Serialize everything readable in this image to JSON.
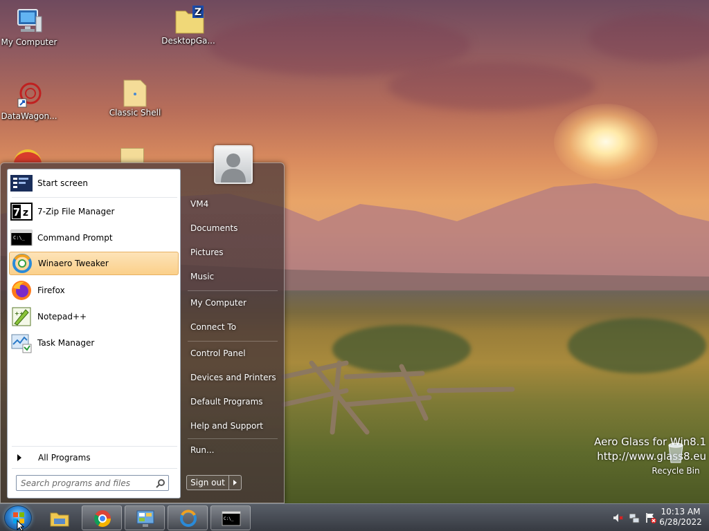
{
  "desktop": {
    "icons": [
      {
        "label": "My Computer"
      },
      {
        "label": "DesktopGa..."
      },
      {
        "label": "DataWagon..."
      },
      {
        "label": "Classic Shell"
      }
    ],
    "watermark": {
      "line1": "Aero Glass for Win8.1",
      "line2": "http://www.glass8.eu"
    },
    "recycle_bin": "Recycle Bin"
  },
  "start_menu": {
    "programs": [
      {
        "label": "Start screen"
      },
      {
        "label": "7-Zip File Manager"
      },
      {
        "label": "Command Prompt"
      },
      {
        "label": "Winaero Tweaker"
      },
      {
        "label": "Firefox"
      },
      {
        "label": "Notepad++"
      },
      {
        "label": "Task Manager"
      }
    ],
    "all_programs": "All Programs",
    "search_placeholder": "Search programs and files",
    "right_items": [
      {
        "label": "VM4"
      },
      {
        "label": "Documents"
      },
      {
        "label": "Pictures"
      },
      {
        "label": "Music"
      },
      {
        "label": "My Computer"
      },
      {
        "label": "Connect To"
      },
      {
        "label": "Control Panel"
      },
      {
        "label": "Devices and Printers"
      },
      {
        "label": "Default Programs"
      },
      {
        "label": "Help and Support"
      },
      {
        "label": "Run..."
      }
    ],
    "sign_out": "Sign out"
  },
  "taskbar": {
    "clock_time": "10:13 AM",
    "clock_date": "6/28/2022"
  }
}
